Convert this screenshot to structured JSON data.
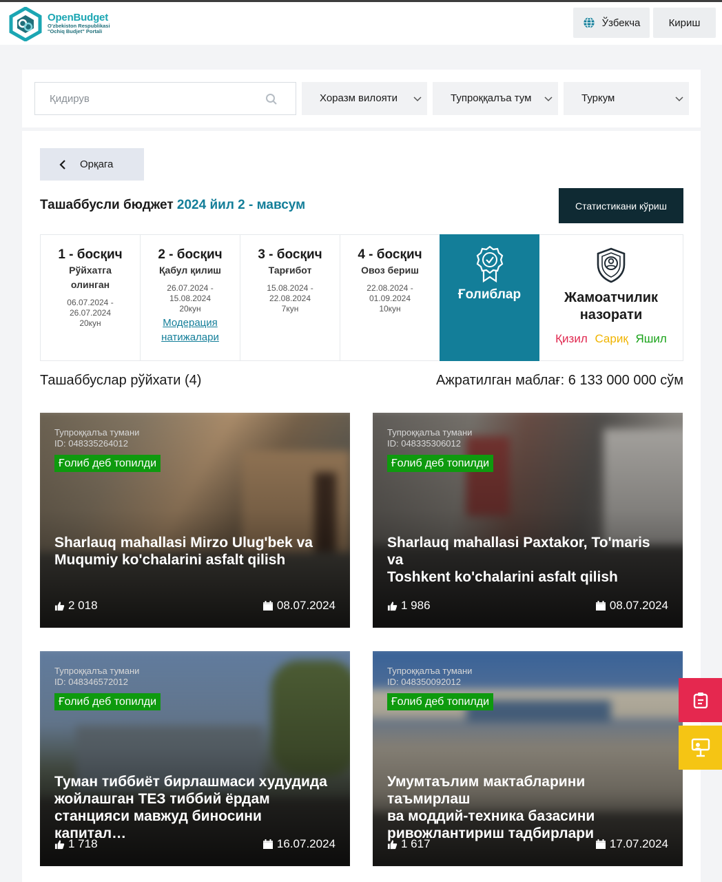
{
  "header": {
    "logo": {
      "name": "OpenBudget",
      "sub1": "O'zbekiston Respublikasi",
      "sub2": "\"Ochiq Budjet\" Portali"
    },
    "language": "Ўзбекча",
    "login": "Кириш"
  },
  "filters": {
    "search_placeholder": "Қидирув",
    "region": "Хоразм вилояти",
    "district": "Тупроққалъа тумани",
    "category": "Туркум"
  },
  "back_label": "Орқага",
  "title": {
    "prefix": "Ташаббусли бюджет",
    "season": "2024 йил 2 - мавсум"
  },
  "stats_button": "Статистикани кўриш",
  "stages": [
    {
      "name": "1 - босқич",
      "desc1": "Рўйхатга",
      "desc2": "олинган",
      "date1": "06.07.2024 -",
      "date2": "26.07.2024",
      "days": "20кун"
    },
    {
      "name": "2 - босқич",
      "desc1": "Қабул қилиш",
      "date1": "26.07.2024 -",
      "date2": "15.08.2024",
      "days": "20кун",
      "link1": "Модерация",
      "link2": "натижалари"
    },
    {
      "name": "3 - босқич",
      "desc1": "Тарғибот",
      "date1": "15.08.2024 -",
      "date2": "22.08.2024",
      "days": "7кун"
    },
    {
      "name": "4 - босқич",
      "desc1": "Овоз бериш",
      "date1": "22.08.2024 -",
      "date2": "01.09.2024",
      "days": "10кун"
    }
  ],
  "winners_label": "Ғолиблар",
  "control": {
    "line1": "Жамоатчилик",
    "line2": "назорати",
    "red": "Қизил",
    "yellow": "Сариқ",
    "green": "Яшил"
  },
  "list_title": "Ташаббуслар рўйхати (4)",
  "budget": "Ажратилган маблағ: 6 133 000 000 сўм",
  "cards": [
    {
      "district": "Тупроққалъа тумани",
      "id": "ID: 048335264012",
      "badge": "Ғолиб деб топилди",
      "line1": "Sharlauq mahallasi Mirzo Ulug'bek va",
      "line2": "Muqumiy ko'chalarini asfalt qilish",
      "likes": "2 018",
      "date": "08.07.2024"
    },
    {
      "district": "Тупроққалъа тумани",
      "id": "ID: 048335306012",
      "badge": "Ғолиб деб топилди",
      "line1": "Sharlauq mahallasi Paxtakor, To'maris va",
      "line2": "Toshkent ko'chalarini asfalt qilish",
      "likes": "1 986",
      "date": "08.07.2024"
    },
    {
      "district": "Тупроққалъа тумани",
      "id": "ID: 048346572012",
      "badge": "Ғолиб деб топилди",
      "line1": "Туман тиббиёт бирлашмаси худудида",
      "line2": "жойлашган ТЕЗ тиббий ёрдам",
      "line3": "станцияси мавжуд биносини капитал…",
      "likes": "1 718",
      "date": "16.07.2024"
    },
    {
      "district": "Тупроққалъа тумани",
      "id": "ID: 048350092012",
      "badge": "Ғолиб деб топилди",
      "line1": "Умумтаълим мактабларини таъмирлаш",
      "line2": "ва моддий-техника базасини",
      "line3": "ривожлантириш тадбирлари",
      "likes": "1 617",
      "date": "17.07.2024"
    }
  ]
}
